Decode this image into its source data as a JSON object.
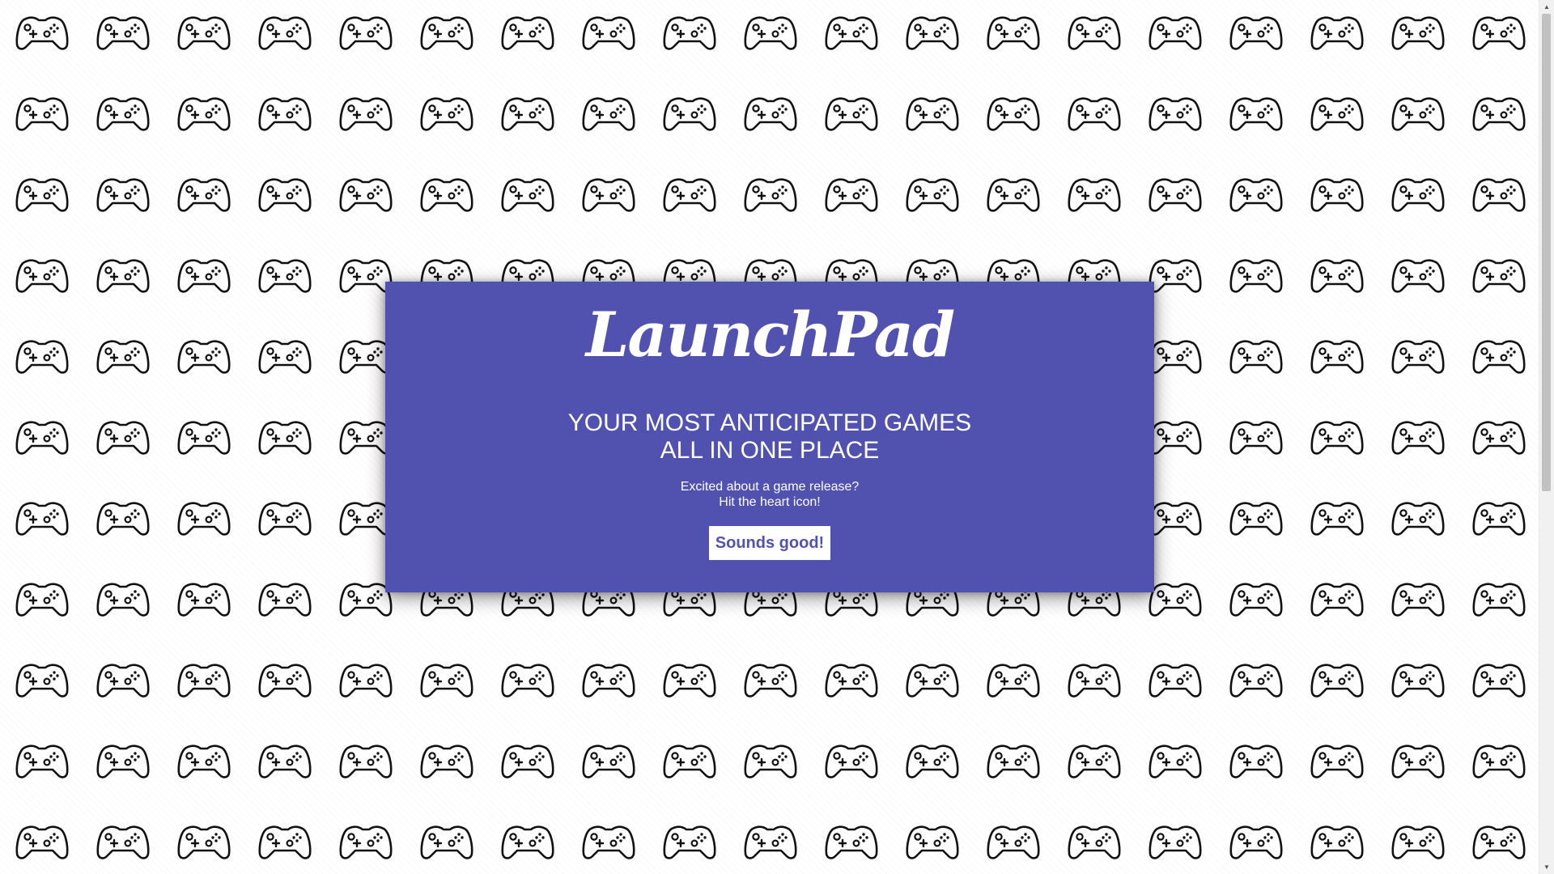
{
  "background": {
    "icon": "gamepad-icon",
    "color": "#111111"
  },
  "modal": {
    "background_color": "#5152af",
    "logo": "LaunchPad",
    "headline_line1": "YOUR MOST ANTICIPATED GAMES",
    "headline_line2": "ALL IN ONE PLACE",
    "sub_line1": "Excited about a game release?",
    "sub_line2": "Hit the heart icon!",
    "cta_label": "Sounds good!"
  }
}
